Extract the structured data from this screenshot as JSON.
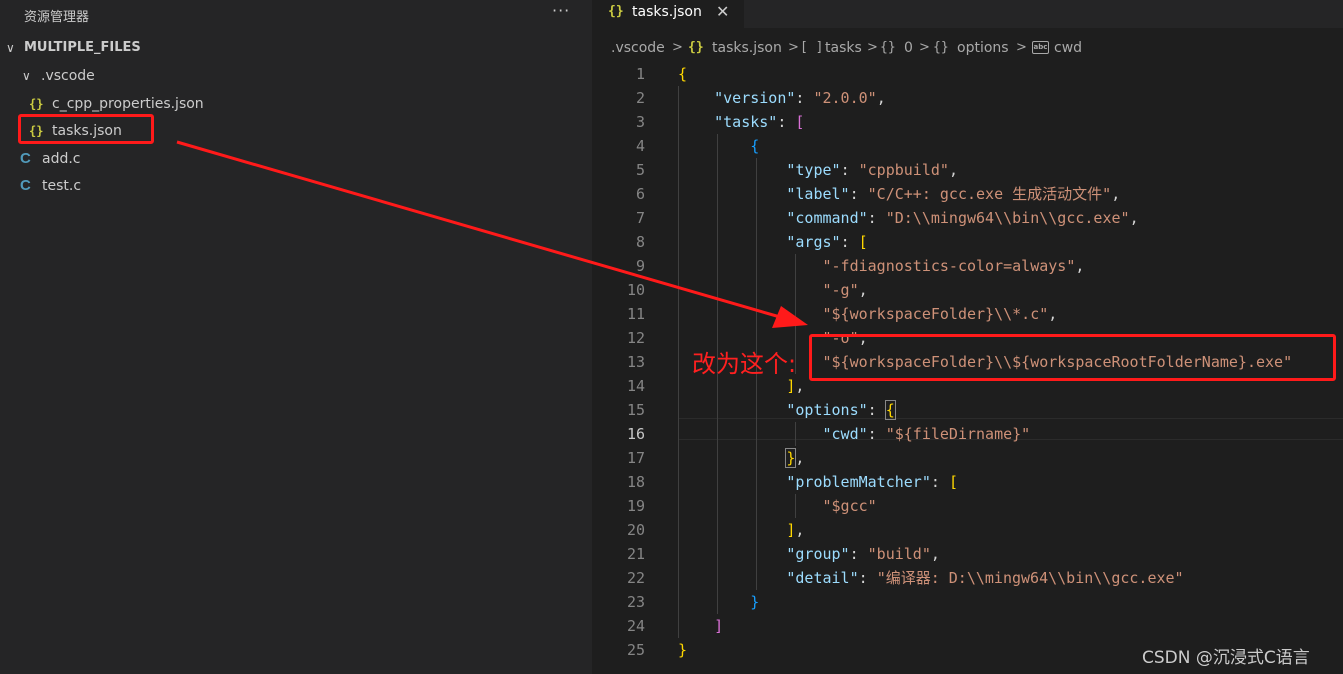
{
  "sidebar": {
    "title": "资源管理器",
    "more": "···",
    "root_folder": "MULTIPLE_FILES",
    "items": [
      {
        "label": ".vscode",
        "icon": "chevron-down-icon"
      },
      {
        "label": "c_cpp_properties.json",
        "icon": "json-icon"
      },
      {
        "label": "tasks.json",
        "icon": "json-icon"
      },
      {
        "label": "add.c",
        "icon": "c-file-icon"
      },
      {
        "label": "test.c",
        "icon": "c-file-icon"
      }
    ],
    "json_glyph": "{}",
    "c_glyph": "C",
    "chevron_glyph": "∨",
    "root_chevron_glyph": "∨"
  },
  "tab": {
    "label": "tasks.json",
    "close": "✕"
  },
  "breadcrumb": {
    "items": [
      ".vscode",
      "tasks.json",
      "tasks",
      "0",
      "options",
      "cwd"
    ],
    "sep": ">",
    "obj_glyph": "{}",
    "arr_glyph": "[ ]",
    "abc_glyph": "abc"
  },
  "editor": {
    "active_line": 16,
    "line_numbers": [
      "1",
      "2",
      "3",
      "4",
      "5",
      "6",
      "7",
      "8",
      "9",
      "10",
      "11",
      "12",
      "13",
      "14",
      "15",
      "16",
      "17",
      "18",
      "19",
      "20",
      "21",
      "22",
      "23",
      "24",
      "25"
    ],
    "lines": {
      "l1_b": "{",
      "l2_k": "\"version\"",
      "l2_p": ": ",
      "l2_s": "\"2.0.0\"",
      "l2_c": ",",
      "l3_k": "\"tasks\"",
      "l3_p": ": ",
      "l3_b": "[",
      "l4_b": "{",
      "l5_k": "\"type\"",
      "l5_p": ": ",
      "l5_s": "\"cppbuild\"",
      "l5_c": ",",
      "l6_k": "\"label\"",
      "l6_p": ": ",
      "l6_s": "\"C/C++: gcc.exe 生成活动文件\"",
      "l6_c": ",",
      "l7_k": "\"command\"",
      "l7_p": ": ",
      "l7_s": "\"D:\\\\mingw64\\\\bin\\\\gcc.exe\"",
      "l7_c": ",",
      "l8_k": "\"args\"",
      "l8_p": ": ",
      "l8_b": "[",
      "l9_s": "\"-fdiagnostics-color=always\"",
      "l9_c": ",",
      "l10_s": "\"-g\"",
      "l10_c": ",",
      "l11_s": "\"${workspaceFolder}\\\\*.c\"",
      "l11_c": ",",
      "l12_s": "\"-o\"",
      "l12_c": ",",
      "l13_s": "\"${workspaceFolder}\\\\${workspaceRootFolderName}.exe\"",
      "l14_b": "]",
      "l14_c": ",",
      "l15_k": "\"options\"",
      "l15_p": ": ",
      "l15_b": "{",
      "l16_k": "\"cwd\"",
      "l16_p": ": ",
      "l16_s": "\"${fileDirname}\"",
      "l17_b": "}",
      "l17_c": ",",
      "l18_k": "\"problemMatcher\"",
      "l18_p": ": ",
      "l18_b": "[",
      "l19_s": "\"$gcc\"",
      "l20_b": "]",
      "l20_c": ",",
      "l21_k": "\"group\"",
      "l21_p": ": ",
      "l21_s": "\"build\"",
      "l21_c": ",",
      "l22_k": "\"detail\"",
      "l22_p": ": ",
      "l22_s": "\"编译器: D:\\\\mingw64\\\\bin\\\\gcc.exe\"",
      "l23_b": "}",
      "l24_b": "]",
      "l25_b": "}"
    }
  },
  "annotation": {
    "text": "改为这个:",
    "color": "#ff1a1a"
  },
  "watermark": "CSDN @沉浸式C语言",
  "colors": {
    "sidebar_bg": "#252526",
    "editor_bg": "#1e1e1e",
    "key": "#9cdcfe",
    "string": "#ce9178",
    "bracket_gold": "#ffd700",
    "bracket_purple": "#da70d6",
    "bracket_blue": "#179fff",
    "json_icon": "#cbcb41",
    "c_icon": "#519aba"
  }
}
